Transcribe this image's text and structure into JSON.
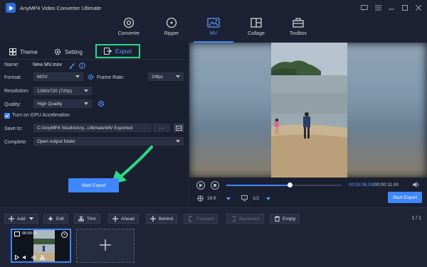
{
  "app": {
    "title": "AnyMP4 Video Converter Ultimate"
  },
  "nav": {
    "items": [
      {
        "label": "Converter"
      },
      {
        "label": "Ripper"
      },
      {
        "label": "MV"
      },
      {
        "label": "Collage"
      },
      {
        "label": "Toolbox"
      }
    ],
    "active": "MV"
  },
  "panel_tabs": {
    "theme": "Theme",
    "setting": "Setting",
    "export": "Export"
  },
  "export": {
    "name_label": "Name:",
    "name_value": "New MV.mov",
    "format_label": "Format:",
    "format_value": "MOV",
    "frame_rate_label": "Frame Rate:",
    "frame_rate_value": "24fps",
    "resolution_label": "Resolution:",
    "resolution_value": "1280x720 (720p)",
    "quality_label": "Quality:",
    "quality_value": "High Quality",
    "gpu_label": "Turn on GPU Acceleration",
    "gpu_checked": true,
    "save_to_label": "Save to:",
    "save_to_value": "C:\\AnyMP4 Studio\\Any...Ultimate\\MV Exported",
    "dots_label": "···",
    "complete_label": "Complete:",
    "complete_value": "Open output folder",
    "start_export_label": "Start Export"
  },
  "player": {
    "current_time": "00:00:06.00",
    "total_time": "/00:00:11.00",
    "progress": 0.55,
    "aspect": "16:9",
    "page": "1/2",
    "export_label": "Start Export"
  },
  "toolbar": {
    "add": "Add",
    "edit": "Edit",
    "trim": "Trim",
    "ahead": "Ahead",
    "behind": "Behind",
    "forward": "Forward",
    "backward": "Backward",
    "empty": "Empty",
    "pager": "1 / 1"
  },
  "clip": {
    "time": "00:00:11"
  },
  "colors": {
    "accent": "#3f86ff",
    "highlight": "#2bd88a",
    "bg": "#1f2536"
  }
}
